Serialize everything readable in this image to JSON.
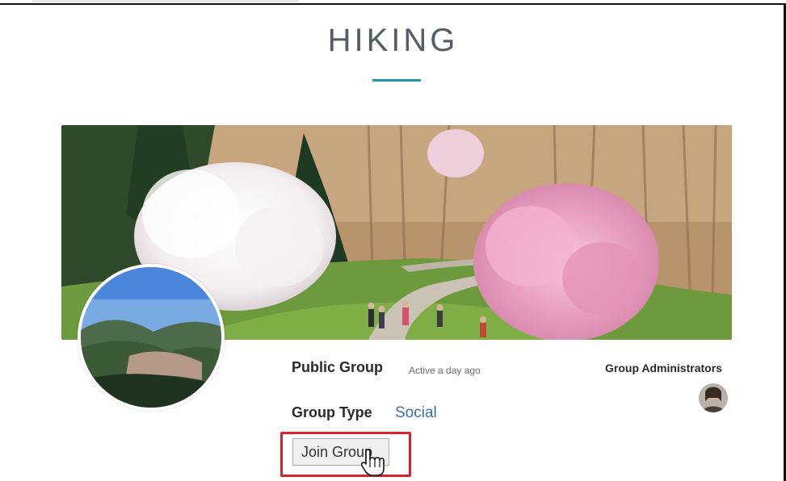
{
  "page": {
    "title": "HIKING"
  },
  "group": {
    "status": "Public Group",
    "activity": "Active a day ago",
    "admins_label": "Group Administrators",
    "type_label": "Group Type",
    "type_value": "Social"
  },
  "actions": {
    "join_label": "Join Group"
  },
  "colors": {
    "accent": "#1e9aa5",
    "link": "#3a6fb0",
    "highlight": "#d9232a"
  },
  "icons": {
    "cursor": "hand-pointer-icon"
  }
}
